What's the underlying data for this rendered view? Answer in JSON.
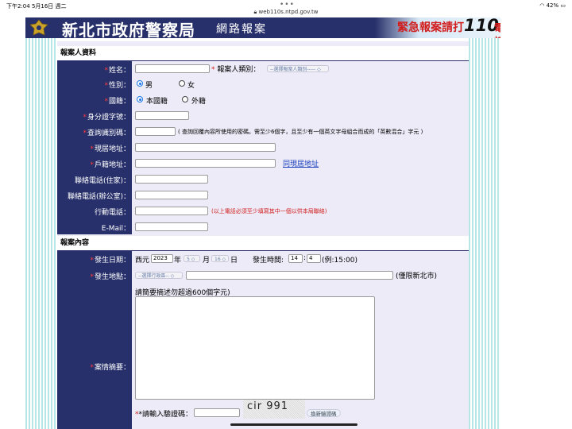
{
  "status_bar": {
    "time": "下午2:04  5月16日 週二",
    "dots": "•••",
    "url": "web110s.ntpd.gov.tw",
    "battery": "42%"
  },
  "banner": {
    "title": "新北市政府警察局",
    "subtitle": "網路報案",
    "emergency_text": "緊急報案請打",
    "emergency_number": "110",
    "emergency_suffix": "電話"
  },
  "reporter_section": {
    "header": "報案人資料",
    "name": {
      "label": "姓名：",
      "value": ""
    },
    "category": {
      "label": "報案人類別：",
      "selected": "--選擇報案人類別----- ◇"
    },
    "gender": {
      "label": "性別：",
      "options": [
        "男",
        "女"
      ],
      "selected": "男"
    },
    "nationality": {
      "label": "國籍：",
      "options": [
        "本國籍",
        "外籍"
      ],
      "selected": "本國籍"
    },
    "id_number": {
      "label": "身分證字號：",
      "value": ""
    },
    "query_code": {
      "label": "查詢識別碼：",
      "value": "",
      "hint": "( 查詢回覆內容所使用的密碼。需至少6個字，且至少有一個英文字母組合而成的「英數混合」字元 )"
    },
    "current_address": {
      "label": "現居地址：",
      "value": ""
    },
    "registered_address": {
      "label": "戶籍地址：",
      "value": "",
      "link": "同現居地址"
    },
    "home_phone": {
      "label": "聯絡電話(住家)：",
      "value": ""
    },
    "office_phone": {
      "label": "聯絡電話(辦公室)：",
      "value": ""
    },
    "mobile_phone": {
      "label": "行動電話：",
      "value": "",
      "note": "(以上電話必須至少填寫其中一個以供本局聯絡)"
    },
    "email": {
      "label": "E-Mail：",
      "value": ""
    }
  },
  "case_section": {
    "header": "報案內容",
    "date": {
      "label": "發生日期：",
      "era": "西元",
      "year": "2023",
      "year_unit": "年",
      "month": "5",
      "month_unit": "月",
      "day": "16",
      "day_unit": "日",
      "time_label": "發生時間:",
      "hour": "14",
      "minute": "4",
      "example": "(例:15:00)"
    },
    "location": {
      "label": "發生地點：",
      "district": "--選擇行政區-- ◇",
      "value": "",
      "note": "(僅限新北市)"
    },
    "summary": {
      "label": "案情摘要：",
      "hint": "請簡要摘述勿超過600個字元)",
      "value": ""
    },
    "captcha": {
      "label": "*請輸入驗證碼：",
      "value": "",
      "image_text": "cir 991",
      "refresh": "換新驗證碼"
    }
  }
}
